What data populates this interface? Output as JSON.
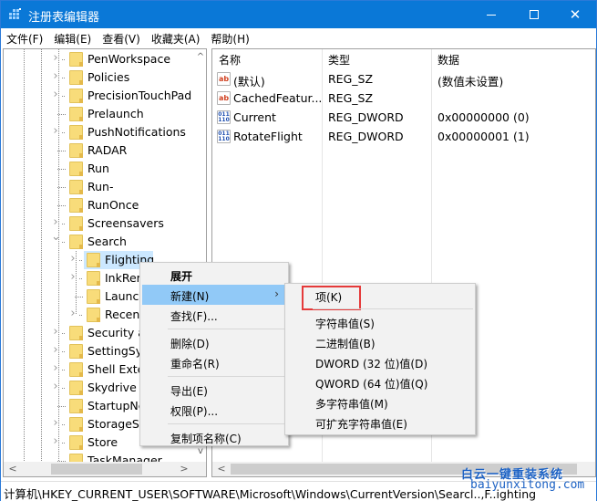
{
  "window": {
    "title": "注册表编辑器",
    "controls": {
      "minimize": "minimize",
      "maximize": "maximize",
      "close": "✕"
    }
  },
  "menubar": {
    "items": [
      "文件(F)",
      "编辑(E)",
      "查看(V)",
      "收藏夹(A)",
      "帮助(H)"
    ]
  },
  "tree": {
    "items": [
      {
        "label": "PenWorkspace",
        "expandable": true,
        "level": 1
      },
      {
        "label": "Policies",
        "expandable": true,
        "level": 1
      },
      {
        "label": "PrecisionTouchPad",
        "expandable": true,
        "level": 1
      },
      {
        "label": "Prelaunch",
        "expandable": false,
        "level": 1
      },
      {
        "label": "PushNotifications",
        "expandable": true,
        "level": 1
      },
      {
        "label": "RADAR",
        "expandable": false,
        "level": 1
      },
      {
        "label": "Run",
        "expandable": false,
        "level": 1
      },
      {
        "label": "Run-",
        "expandable": false,
        "level": 1
      },
      {
        "label": "RunOnce",
        "expandable": false,
        "level": 1
      },
      {
        "label": "Screensavers",
        "expandable": true,
        "level": 1
      },
      {
        "label": "Search",
        "expandable": true,
        "expanded": true,
        "level": 1
      },
      {
        "label": "Flighting",
        "expandable": true,
        "level": 2,
        "selected": true
      },
      {
        "label": "InkRer",
        "expandable": true,
        "level": 2
      },
      {
        "label": "Launch",
        "expandable": false,
        "level": 2
      },
      {
        "label": "Recent",
        "expandable": true,
        "level": 2
      },
      {
        "label": "Security a",
        "expandable": true,
        "level": 1
      },
      {
        "label": "SettingSyr",
        "expandable": true,
        "level": 1
      },
      {
        "label": "Shell Exter",
        "expandable": true,
        "level": 1
      },
      {
        "label": "Skydrive",
        "expandable": true,
        "level": 1
      },
      {
        "label": "StartupNc",
        "expandable": false,
        "level": 1
      },
      {
        "label": "StorageSe",
        "expandable": true,
        "level": 1
      },
      {
        "label": "Store",
        "expandable": true,
        "level": 1
      },
      {
        "label": "TaskManager",
        "expandable": false,
        "level": 1
      }
    ]
  },
  "list": {
    "columns": [
      "名称",
      "类型",
      "数据"
    ],
    "rows": [
      {
        "icon": "string-value-icon",
        "icon_text": "ab",
        "kind": "sz",
        "name": "(默认)",
        "type": "REG_SZ",
        "data": "(数值未设置)"
      },
      {
        "icon": "string-value-icon",
        "icon_text": "ab",
        "kind": "sz",
        "name": "CachedFeatur...",
        "type": "REG_SZ",
        "data": ""
      },
      {
        "icon": "binary-value-icon",
        "icon_text": "011 110",
        "kind": "dword",
        "name": "Current",
        "type": "REG_DWORD",
        "data": "0x00000000 (0)"
      },
      {
        "icon": "binary-value-icon",
        "icon_text": "011 110",
        "kind": "dword",
        "name": "RotateFlight",
        "type": "REG_DWORD",
        "data": "0x00000001 (1)"
      }
    ]
  },
  "context_menu": {
    "items": [
      {
        "label": "展开",
        "bold": true
      },
      {
        "label": "新建(N)",
        "submenu": true,
        "hover": true
      },
      {
        "label": "查找(F)..."
      },
      {
        "separator": true
      },
      {
        "label": "删除(D)"
      },
      {
        "label": "重命名(R)"
      },
      {
        "separator": true
      },
      {
        "label": "导出(E)"
      },
      {
        "label": "权限(P)..."
      },
      {
        "separator": true
      },
      {
        "label": "复制项名称(C)"
      }
    ],
    "arrow": "›"
  },
  "submenu": {
    "items": [
      {
        "label": "项(K)",
        "highlighted": true
      },
      {
        "separator": true
      },
      {
        "label": "字符串值(S)"
      },
      {
        "label": "二进制值(B)"
      },
      {
        "label": "DWORD (32 位)值(D)"
      },
      {
        "label": "QWORD (64 位)值(Q)"
      },
      {
        "label": "多字符串值(M)"
      },
      {
        "label": "可扩充字符串值(E)"
      }
    ],
    "highlight_color": "#e53a3a"
  },
  "statusbar": {
    "path": "计算机\\HKEY_CURRENT_USER\\SOFTWARE\\Microsoft\\Windows\\CurrentVersion\\Searcl..‚F..ighting"
  },
  "watermark": {
    "line1": "白云一键重装系统",
    "line2": "baiyunxitong.com"
  },
  "scroll": {
    "up": "^",
    "down": "v",
    "left": "<",
    "right": ">"
  },
  "colors": {
    "titlebar": "#0a78d7",
    "selection": "#cce8ff",
    "menu_hover": "#91c9f7"
  }
}
